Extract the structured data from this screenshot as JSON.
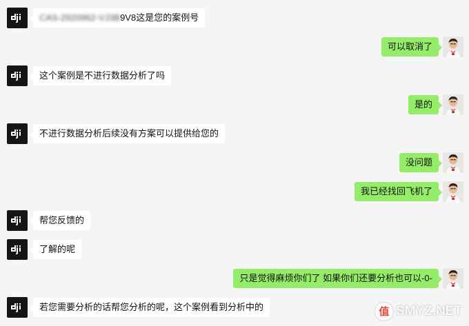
{
  "messages": [
    {
      "side": "left",
      "blurred_prefix": "CAS-2920962-VJ3B",
      "text": "9V8这是您的案例号"
    },
    {
      "side": "right",
      "text": "可以取消了"
    },
    {
      "side": "left",
      "text": "这个案例是不进行数据分析了吗"
    },
    {
      "side": "right",
      "text": "是的"
    },
    {
      "side": "left",
      "text": "不进行数据分析后续没有方案可以提供给您的"
    },
    {
      "side": "right",
      "text": "没问题"
    },
    {
      "side": "right",
      "text": "我已经找回飞机了"
    },
    {
      "side": "left",
      "text": "帮您反馈的"
    },
    {
      "side": "left",
      "text": "了解的呢"
    },
    {
      "side": "right",
      "text": "只是觉得麻烦你们了  如果你们还要分析也可以-0-"
    },
    {
      "side": "left",
      "text": "若您需要分析的话帮您分析的呢，这个案例看到分析中的"
    }
  ],
  "avatars": {
    "left_icon": "dji-logo-icon",
    "right_icon": "user-photo-avatar"
  },
  "colors": {
    "background": "#f5f5f5",
    "left_bubble": "#ffffff",
    "right_bubble": "#95ec69",
    "dji_avatar_bg": "#151515"
  },
  "watermark": {
    "logo_char": "值",
    "text": "SMYZ.NET"
  }
}
